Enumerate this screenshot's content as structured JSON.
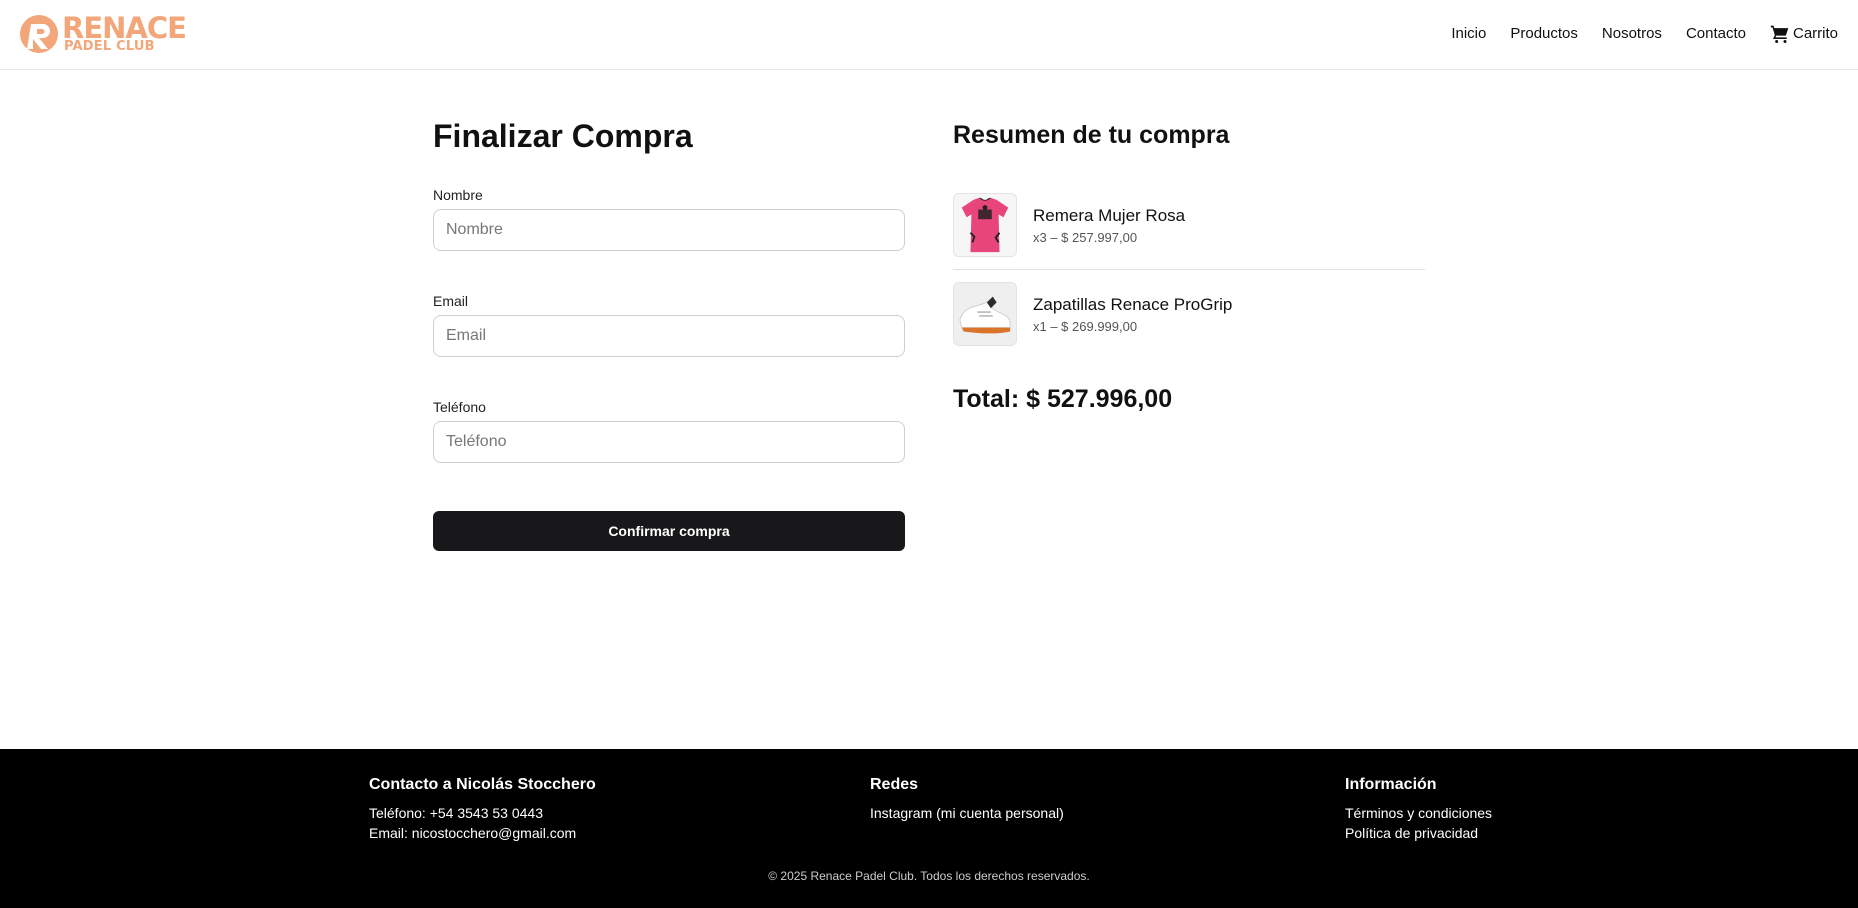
{
  "brand": {
    "name": "RENACE",
    "tagline": "PADEL CLUB",
    "color": "#f2a679"
  },
  "nav": {
    "items": [
      {
        "label": "Inicio"
      },
      {
        "label": "Productos"
      },
      {
        "label": "Nosotros"
      },
      {
        "label": "Contacto"
      }
    ],
    "cart": {
      "label": "Carrito",
      "icon": "cart-icon"
    }
  },
  "checkout": {
    "title": "Finalizar Compra",
    "fields": [
      {
        "label": "Nombre",
        "placeholder": "Nombre",
        "value": ""
      },
      {
        "label": "Email",
        "placeholder": "Email",
        "value": ""
      },
      {
        "label": "Teléfono",
        "placeholder": "Teléfono",
        "value": ""
      }
    ],
    "confirm_label": "Confirmar compra",
    "button_color": "#18181a"
  },
  "summary": {
    "title": "Resumen de tu compra",
    "items": [
      {
        "name": "Remera Mujer Rosa",
        "detail": "x3 – $ 257.997,00",
        "image": "pink-shirt"
      },
      {
        "name": "Zapatillas Renace ProGrip",
        "detail": "x1 – $ 269.999,00",
        "image": "white-sneaker"
      }
    ],
    "total": "Total: $ 527.996,00"
  },
  "footer": {
    "contact": {
      "title": "Contacto a Nicolás Stocchero",
      "phone": "Teléfono: +54 3543 53 0443",
      "email": "Email: nicostocchero@gmail.com"
    },
    "social": {
      "title": "Redes",
      "instagram": "Instagram (mi cuenta personal)"
    },
    "info": {
      "title": "Información",
      "terms": "Términos y condiciones",
      "privacy": "Política de privacidad"
    },
    "copyright": "© 2025 Renace Padel Club. Todos los derechos reservados."
  }
}
